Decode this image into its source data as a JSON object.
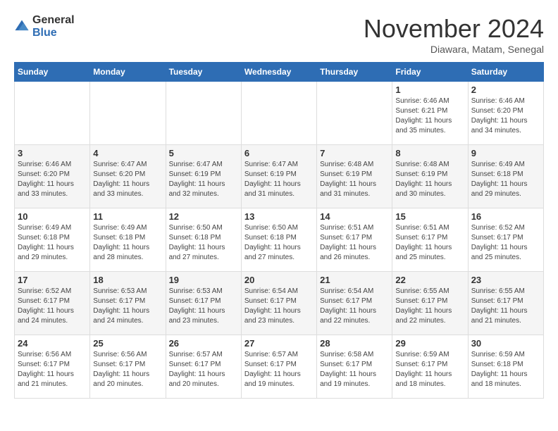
{
  "logo": {
    "general": "General",
    "blue": "Blue"
  },
  "header": {
    "month": "November 2024",
    "location": "Diawara, Matam, Senegal"
  },
  "weekdays": [
    "Sunday",
    "Monday",
    "Tuesday",
    "Wednesday",
    "Thursday",
    "Friday",
    "Saturday"
  ],
  "weeks": [
    [
      {
        "day": "",
        "info": ""
      },
      {
        "day": "",
        "info": ""
      },
      {
        "day": "",
        "info": ""
      },
      {
        "day": "",
        "info": ""
      },
      {
        "day": "",
        "info": ""
      },
      {
        "day": "1",
        "info": "Sunrise: 6:46 AM\nSunset: 6:21 PM\nDaylight: 11 hours and 35 minutes."
      },
      {
        "day": "2",
        "info": "Sunrise: 6:46 AM\nSunset: 6:20 PM\nDaylight: 11 hours and 34 minutes."
      }
    ],
    [
      {
        "day": "3",
        "info": "Sunrise: 6:46 AM\nSunset: 6:20 PM\nDaylight: 11 hours and 33 minutes."
      },
      {
        "day": "4",
        "info": "Sunrise: 6:47 AM\nSunset: 6:20 PM\nDaylight: 11 hours and 33 minutes."
      },
      {
        "day": "5",
        "info": "Sunrise: 6:47 AM\nSunset: 6:19 PM\nDaylight: 11 hours and 32 minutes."
      },
      {
        "day": "6",
        "info": "Sunrise: 6:47 AM\nSunset: 6:19 PM\nDaylight: 11 hours and 31 minutes."
      },
      {
        "day": "7",
        "info": "Sunrise: 6:48 AM\nSunset: 6:19 PM\nDaylight: 11 hours and 31 minutes."
      },
      {
        "day": "8",
        "info": "Sunrise: 6:48 AM\nSunset: 6:19 PM\nDaylight: 11 hours and 30 minutes."
      },
      {
        "day": "9",
        "info": "Sunrise: 6:49 AM\nSunset: 6:18 PM\nDaylight: 11 hours and 29 minutes."
      }
    ],
    [
      {
        "day": "10",
        "info": "Sunrise: 6:49 AM\nSunset: 6:18 PM\nDaylight: 11 hours and 29 minutes."
      },
      {
        "day": "11",
        "info": "Sunrise: 6:49 AM\nSunset: 6:18 PM\nDaylight: 11 hours and 28 minutes."
      },
      {
        "day": "12",
        "info": "Sunrise: 6:50 AM\nSunset: 6:18 PM\nDaylight: 11 hours and 27 minutes."
      },
      {
        "day": "13",
        "info": "Sunrise: 6:50 AM\nSunset: 6:18 PM\nDaylight: 11 hours and 27 minutes."
      },
      {
        "day": "14",
        "info": "Sunrise: 6:51 AM\nSunset: 6:17 PM\nDaylight: 11 hours and 26 minutes."
      },
      {
        "day": "15",
        "info": "Sunrise: 6:51 AM\nSunset: 6:17 PM\nDaylight: 11 hours and 25 minutes."
      },
      {
        "day": "16",
        "info": "Sunrise: 6:52 AM\nSunset: 6:17 PM\nDaylight: 11 hours and 25 minutes."
      }
    ],
    [
      {
        "day": "17",
        "info": "Sunrise: 6:52 AM\nSunset: 6:17 PM\nDaylight: 11 hours and 24 minutes."
      },
      {
        "day": "18",
        "info": "Sunrise: 6:53 AM\nSunset: 6:17 PM\nDaylight: 11 hours and 24 minutes."
      },
      {
        "day": "19",
        "info": "Sunrise: 6:53 AM\nSunset: 6:17 PM\nDaylight: 11 hours and 23 minutes."
      },
      {
        "day": "20",
        "info": "Sunrise: 6:54 AM\nSunset: 6:17 PM\nDaylight: 11 hours and 23 minutes."
      },
      {
        "day": "21",
        "info": "Sunrise: 6:54 AM\nSunset: 6:17 PM\nDaylight: 11 hours and 22 minutes."
      },
      {
        "day": "22",
        "info": "Sunrise: 6:55 AM\nSunset: 6:17 PM\nDaylight: 11 hours and 22 minutes."
      },
      {
        "day": "23",
        "info": "Sunrise: 6:55 AM\nSunset: 6:17 PM\nDaylight: 11 hours and 21 minutes."
      }
    ],
    [
      {
        "day": "24",
        "info": "Sunrise: 6:56 AM\nSunset: 6:17 PM\nDaylight: 11 hours and 21 minutes."
      },
      {
        "day": "25",
        "info": "Sunrise: 6:56 AM\nSunset: 6:17 PM\nDaylight: 11 hours and 20 minutes."
      },
      {
        "day": "26",
        "info": "Sunrise: 6:57 AM\nSunset: 6:17 PM\nDaylight: 11 hours and 20 minutes."
      },
      {
        "day": "27",
        "info": "Sunrise: 6:57 AM\nSunset: 6:17 PM\nDaylight: 11 hours and 19 minutes."
      },
      {
        "day": "28",
        "info": "Sunrise: 6:58 AM\nSunset: 6:17 PM\nDaylight: 11 hours and 19 minutes."
      },
      {
        "day": "29",
        "info": "Sunrise: 6:59 AM\nSunset: 6:17 PM\nDaylight: 11 hours and 18 minutes."
      },
      {
        "day": "30",
        "info": "Sunrise: 6:59 AM\nSunset: 6:18 PM\nDaylight: 11 hours and 18 minutes."
      }
    ]
  ]
}
